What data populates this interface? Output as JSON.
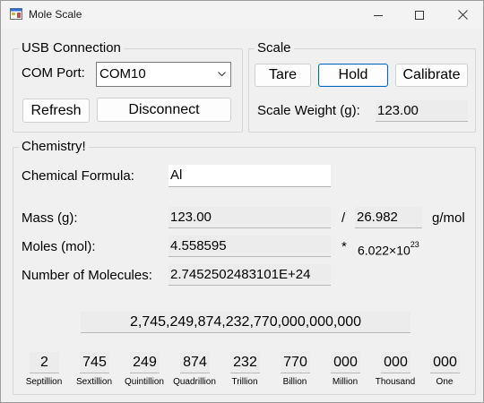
{
  "window": {
    "title": "Mole Scale"
  },
  "usb": {
    "group_title": "USB Connection",
    "com_port_label": "COM Port:",
    "com_port_value": "COM10",
    "refresh_label": "Refresh",
    "disconnect_label": "Disconnect"
  },
  "scale": {
    "group_title": "Scale",
    "tare_label": "Tare",
    "hold_label": "Hold",
    "calibrate_label": "Calibrate",
    "weight_label": "Scale Weight (g):",
    "weight_value": "123.00"
  },
  "chemistry": {
    "group_title": "Chemistry!",
    "formula_label": "Chemical Formula:",
    "formula_value": "Al",
    "mass_label": "Mass (g):",
    "mass_value": "123.00",
    "divide_symbol": "/",
    "molar_mass_value": "26.982",
    "molar_mass_unit": "g/mol",
    "moles_label": "Moles (mol):",
    "moles_value": "4.558595",
    "multiply_symbol": "*",
    "avogadro_base": "6.022×10",
    "avogadro_exp": "23",
    "molecules_label": "Number of Molecules:",
    "molecules_value": "2.7452502483101E+24",
    "full_number": "2,745,249,874,232,770,000,000,000",
    "groups": [
      {
        "value": "2",
        "unit": "Septillion"
      },
      {
        "value": "745",
        "unit": "Sextillion"
      },
      {
        "value": "249",
        "unit": "Quintillion"
      },
      {
        "value": "874",
        "unit": "Quadrillion"
      },
      {
        "value": "232",
        "unit": "Trillion"
      },
      {
        "value": "770",
        "unit": "Billion"
      },
      {
        "value": "000",
        "unit": "Million"
      },
      {
        "value": "000",
        "unit": "Thousand"
      },
      {
        "value": "000",
        "unit": "One"
      }
    ]
  }
}
